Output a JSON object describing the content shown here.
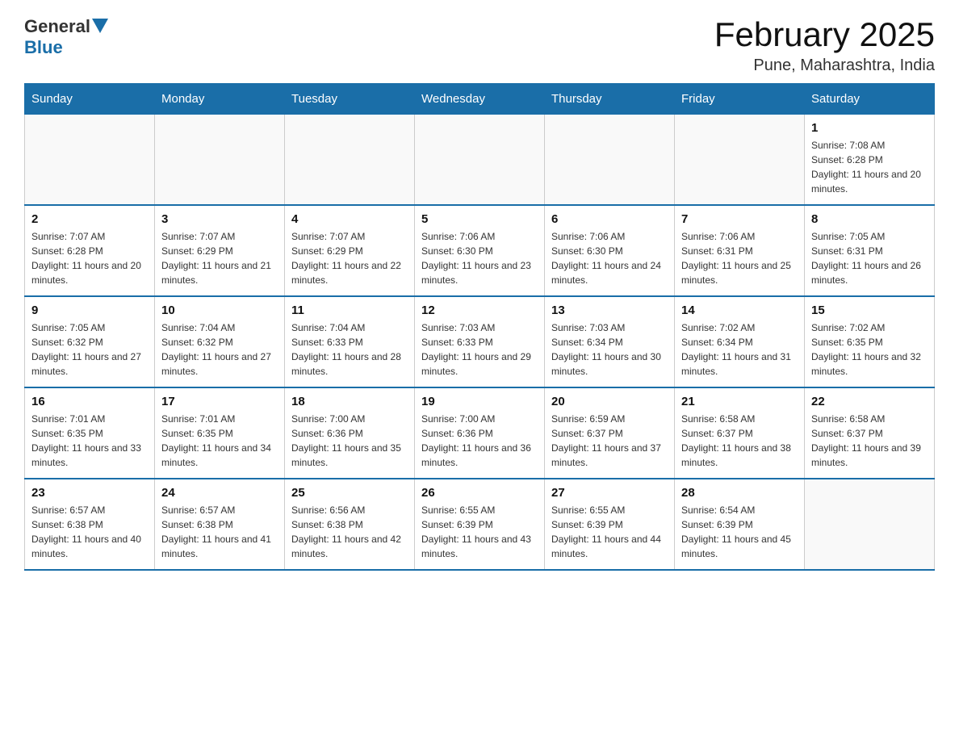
{
  "header": {
    "logo_general": "General",
    "logo_blue": "Blue",
    "month_title": "February 2025",
    "location": "Pune, Maharashtra, India"
  },
  "days_of_week": [
    "Sunday",
    "Monday",
    "Tuesday",
    "Wednesday",
    "Thursday",
    "Friday",
    "Saturday"
  ],
  "weeks": [
    [
      {
        "day": "",
        "info": ""
      },
      {
        "day": "",
        "info": ""
      },
      {
        "day": "",
        "info": ""
      },
      {
        "day": "",
        "info": ""
      },
      {
        "day": "",
        "info": ""
      },
      {
        "day": "",
        "info": ""
      },
      {
        "day": "1",
        "info": "Sunrise: 7:08 AM\nSunset: 6:28 PM\nDaylight: 11 hours and 20 minutes."
      }
    ],
    [
      {
        "day": "2",
        "info": "Sunrise: 7:07 AM\nSunset: 6:28 PM\nDaylight: 11 hours and 20 minutes."
      },
      {
        "day": "3",
        "info": "Sunrise: 7:07 AM\nSunset: 6:29 PM\nDaylight: 11 hours and 21 minutes."
      },
      {
        "day": "4",
        "info": "Sunrise: 7:07 AM\nSunset: 6:29 PM\nDaylight: 11 hours and 22 minutes."
      },
      {
        "day": "5",
        "info": "Sunrise: 7:06 AM\nSunset: 6:30 PM\nDaylight: 11 hours and 23 minutes."
      },
      {
        "day": "6",
        "info": "Sunrise: 7:06 AM\nSunset: 6:30 PM\nDaylight: 11 hours and 24 minutes."
      },
      {
        "day": "7",
        "info": "Sunrise: 7:06 AM\nSunset: 6:31 PM\nDaylight: 11 hours and 25 minutes."
      },
      {
        "day": "8",
        "info": "Sunrise: 7:05 AM\nSunset: 6:31 PM\nDaylight: 11 hours and 26 minutes."
      }
    ],
    [
      {
        "day": "9",
        "info": "Sunrise: 7:05 AM\nSunset: 6:32 PM\nDaylight: 11 hours and 27 minutes."
      },
      {
        "day": "10",
        "info": "Sunrise: 7:04 AM\nSunset: 6:32 PM\nDaylight: 11 hours and 27 minutes."
      },
      {
        "day": "11",
        "info": "Sunrise: 7:04 AM\nSunset: 6:33 PM\nDaylight: 11 hours and 28 minutes."
      },
      {
        "day": "12",
        "info": "Sunrise: 7:03 AM\nSunset: 6:33 PM\nDaylight: 11 hours and 29 minutes."
      },
      {
        "day": "13",
        "info": "Sunrise: 7:03 AM\nSunset: 6:34 PM\nDaylight: 11 hours and 30 minutes."
      },
      {
        "day": "14",
        "info": "Sunrise: 7:02 AM\nSunset: 6:34 PM\nDaylight: 11 hours and 31 minutes."
      },
      {
        "day": "15",
        "info": "Sunrise: 7:02 AM\nSunset: 6:35 PM\nDaylight: 11 hours and 32 minutes."
      }
    ],
    [
      {
        "day": "16",
        "info": "Sunrise: 7:01 AM\nSunset: 6:35 PM\nDaylight: 11 hours and 33 minutes."
      },
      {
        "day": "17",
        "info": "Sunrise: 7:01 AM\nSunset: 6:35 PM\nDaylight: 11 hours and 34 minutes."
      },
      {
        "day": "18",
        "info": "Sunrise: 7:00 AM\nSunset: 6:36 PM\nDaylight: 11 hours and 35 minutes."
      },
      {
        "day": "19",
        "info": "Sunrise: 7:00 AM\nSunset: 6:36 PM\nDaylight: 11 hours and 36 minutes."
      },
      {
        "day": "20",
        "info": "Sunrise: 6:59 AM\nSunset: 6:37 PM\nDaylight: 11 hours and 37 minutes."
      },
      {
        "day": "21",
        "info": "Sunrise: 6:58 AM\nSunset: 6:37 PM\nDaylight: 11 hours and 38 minutes."
      },
      {
        "day": "22",
        "info": "Sunrise: 6:58 AM\nSunset: 6:37 PM\nDaylight: 11 hours and 39 minutes."
      }
    ],
    [
      {
        "day": "23",
        "info": "Sunrise: 6:57 AM\nSunset: 6:38 PM\nDaylight: 11 hours and 40 minutes."
      },
      {
        "day": "24",
        "info": "Sunrise: 6:57 AM\nSunset: 6:38 PM\nDaylight: 11 hours and 41 minutes."
      },
      {
        "day": "25",
        "info": "Sunrise: 6:56 AM\nSunset: 6:38 PM\nDaylight: 11 hours and 42 minutes."
      },
      {
        "day": "26",
        "info": "Sunrise: 6:55 AM\nSunset: 6:39 PM\nDaylight: 11 hours and 43 minutes."
      },
      {
        "day": "27",
        "info": "Sunrise: 6:55 AM\nSunset: 6:39 PM\nDaylight: 11 hours and 44 minutes."
      },
      {
        "day": "28",
        "info": "Sunrise: 6:54 AM\nSunset: 6:39 PM\nDaylight: 11 hours and 45 minutes."
      },
      {
        "day": "",
        "info": ""
      }
    ]
  ]
}
